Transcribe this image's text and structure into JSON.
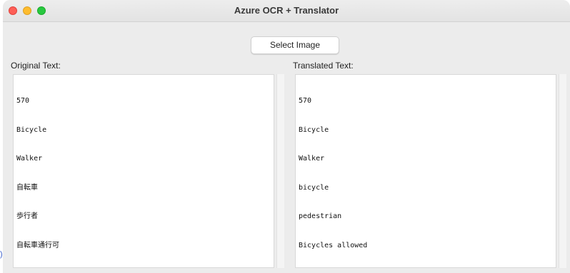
{
  "window": {
    "title": "Azure OCR + Translator"
  },
  "toolbar": {
    "select_image_label": "Select Image"
  },
  "original": {
    "label": "Original Text:",
    "lines": [
      "570",
      "Bicycle",
      "Walker",
      "自転車",
      "歩行者",
      "自転車通行可"
    ]
  },
  "translated": {
    "label": "Translated Text:",
    "lines": [
      "570",
      "Bicycle",
      "Walker",
      "bicycle",
      "pedestrian",
      "Bicycles allowed"
    ]
  },
  "stray_glyph": ")"
}
